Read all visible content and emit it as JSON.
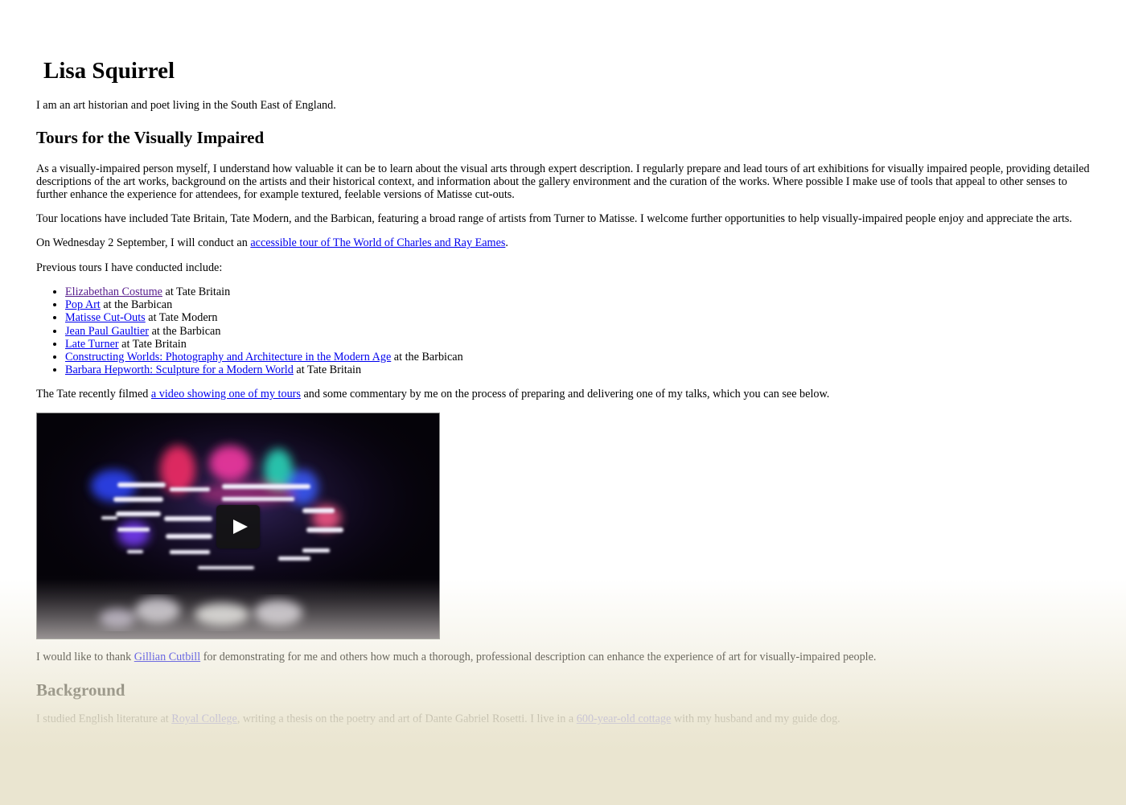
{
  "site": {
    "title": "Lisa Squirrel",
    "intro": "I am an art historian and poet living in the South East of England."
  },
  "tours_section": {
    "heading": "Tours for the Visually Impaired",
    "p1": "As a visually-impaired person myself, I understand how valuable it can be to learn about the visual arts through expert description. I regularly prepare and lead tours of art exhibitions for visually impaired people, providing detailed descriptions of the art works, background on the artists and their historical context, and information about the gallery environment and the curation of the works. Where possible I make use of tools that appeal to other senses to further enhance the experience for attendees, for example textured, feelable versions of Matisse cut-outs.",
    "p2": "Tour locations have included Tate Britain, Tate Modern, and the Barbican, featuring a broad range of artists from Turner to Matisse. I welcome further opportunities to help visually-impaired people enjoy and appreciate the arts.",
    "p3_prefix": "On Wednesday 2 September, I will conduct an ",
    "p3_link": "accessible tour of The World of Charles and Ray Eames",
    "p3_suffix": ".",
    "p4": "Previous tours I have conducted include:",
    "previous_tours": [
      {
        "link": "Elizabethan Costume",
        "suffix": " at Tate Britain"
      },
      {
        "link": "Pop Art",
        "suffix": " at the Barbican"
      },
      {
        "link": "Matisse Cut-Outs",
        "suffix": " at Tate Modern"
      },
      {
        "link": "Jean Paul Gaultier",
        "suffix": " at the Barbican"
      },
      {
        "link": "Late Turner",
        "suffix": " at Tate Britain"
      },
      {
        "link": "Constructing Worlds: Photography and Architecture in the Modern Age",
        "suffix": " at the Barbican"
      },
      {
        "link": "Barbara Hepworth: Sculpture for a Modern World",
        "suffix": " at Tate Britain"
      }
    ],
    "p5_prefix": "The Tate recently filmed ",
    "p5_link": "a video showing one of my tours",
    "p5_suffix": " and some commentary by me on the process of preparing and delivering one of my talks, which you can see below.",
    "p6_prefix": "I would like to thank ",
    "p6_link": "Gillian Cutbill",
    "p6_suffix": " for demonstrating for me and others how much a thorough, professional description can enhance the experience of art for visually-impaired people."
  },
  "background_section": {
    "heading": "Background",
    "p_prefix": "I studied English literature at ",
    "p_link1": "Royal College",
    "p_mid": ", writing a thesis on the poetry and art of Dante Gabriel Rosetti. I live in a ",
    "p_link2": "600-year-old cottage",
    "p_suffix": " with my husband and my guide dog."
  },
  "video": {
    "play_icon": "play-icon"
  },
  "colors": {
    "link": "#0000ee",
    "visited_link": "#551a8b",
    "fade": "#eae5d0"
  }
}
